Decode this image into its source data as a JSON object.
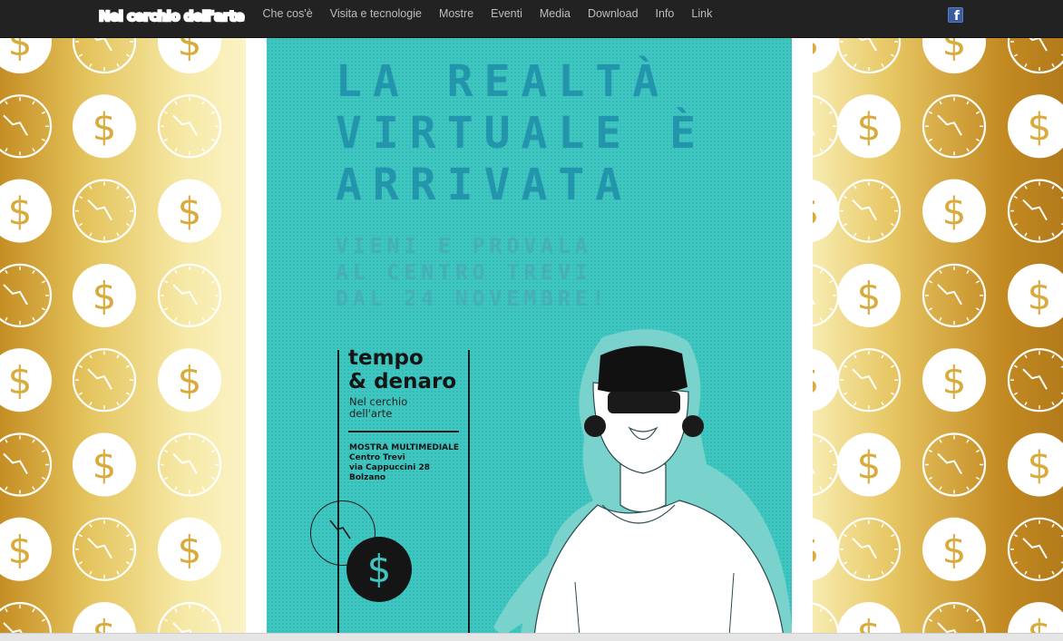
{
  "site": {
    "logo_text": "Nel cerchio dell'arte"
  },
  "nav": {
    "items": [
      {
        "label": "Che cos'è"
      },
      {
        "label": "Visita e tecnologie"
      },
      {
        "label": "Mostre"
      },
      {
        "label": "Eventi"
      },
      {
        "label": "Media"
      },
      {
        "label": "Download"
      },
      {
        "label": "Info"
      },
      {
        "label": "Link"
      }
    ],
    "facebook_icon": "facebook-icon"
  },
  "poster": {
    "headline": [
      "LA REALTÀ",
      "VIRTUALE È",
      "ARRIVATA"
    ],
    "subheadline": [
      "VIENI E PROVALA",
      "AL CENTRO TREVI",
      "DAL 24 NOVEMBRE!"
    ],
    "title_line1": "tempo",
    "title_line2": "& denaro",
    "subtitle_line1": "Nel cerchio",
    "subtitle_line2": "dell'arte",
    "exhibit_type": "MOSTRA MULTIMEDIALE",
    "venue": "Centro Trevi",
    "address": "via Cappuccini 28",
    "city": "Bolzano",
    "coin_symbol": "$",
    "illustration": "person-with-vr-headset"
  },
  "background": {
    "pattern": "gold clocks and dollar coins",
    "icons": [
      "clock-icon",
      "dollar-coin-icon"
    ]
  },
  "colors": {
    "navbar": "#222222",
    "nav_text": "#bdbdbd",
    "poster_teal": "#3ec7c0",
    "headline_blue": "#1f8da9",
    "gold": "#e4c35c"
  }
}
